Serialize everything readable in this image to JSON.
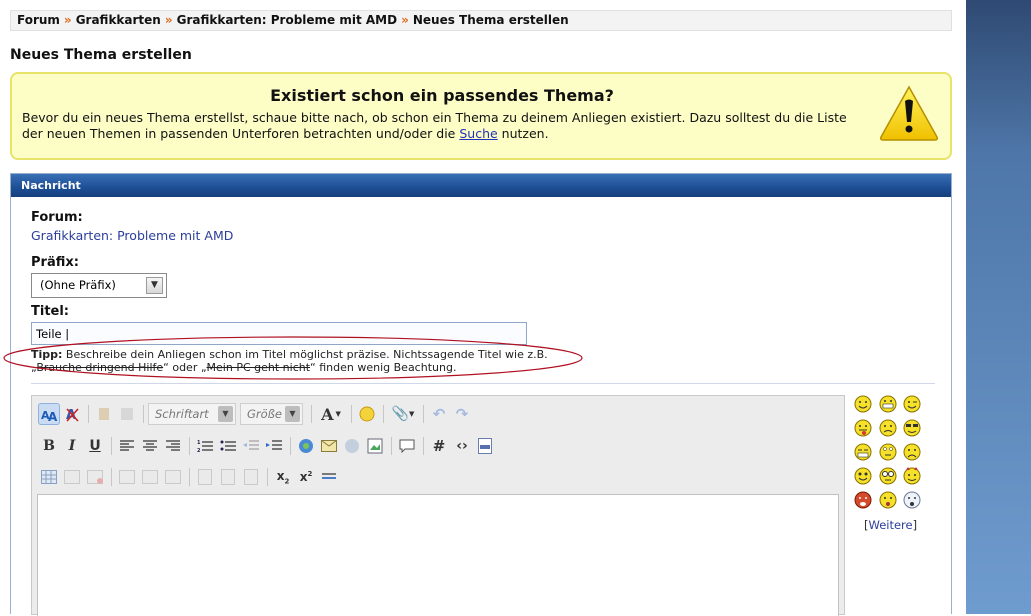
{
  "breadcrumb": {
    "items": [
      "Forum",
      "Grafikkarten",
      "Grafikkarten: Probleme mit AMD",
      "Neues Thema erstellen"
    ],
    "separator": "»"
  },
  "page_title": "Neues Thema erstellen",
  "notice": {
    "title": "Existiert schon ein passendes Thema?",
    "text_before": "Bevor du ein neues Thema erstellst, schaue bitte nach, ob schon ein Thema zu deinem Anliegen existiert. Dazu solltest du die Liste der neuen Themen in passenden Unterforen betrachten und/oder die ",
    "link": "Suche",
    "text_after": " nutzen."
  },
  "panel": {
    "header": "Nachricht",
    "forum_label": "Forum:",
    "forum_value": "Grafikkarten: Probleme mit AMD",
    "prefix_label": "Präfix:",
    "prefix_value": "(Ohne Präfix)",
    "title_label": "Titel:",
    "title_value": "Teile |",
    "tip": {
      "label": "Tipp:",
      "text1": " Beschreibe dein Anliegen schon im Titel möglichst präzise. Nichtssagende Titel wie z.B. „",
      "strike1": "Brauche dringend Hilfe",
      "text2": "“ oder „",
      "strike2": "Mein PC geht nicht",
      "text3": "“ finden wenig Beachtung."
    }
  },
  "editor": {
    "font_combo": "Schriftart",
    "size_combo": "Größe",
    "toolbar_icons": {
      "row1": [
        "switch-mode-icon",
        "remove-format-icon",
        "cut-icon",
        "paste-icon",
        "font-combo",
        "size-combo",
        "font-color-icon",
        "smilie-icon",
        "attachment-icon",
        "undo-icon",
        "redo-icon"
      ],
      "row2": [
        "bold-icon",
        "italic-icon",
        "underline-icon",
        "align-left-icon",
        "align-center-icon",
        "align-right-icon",
        "ordered-list-icon",
        "unordered-list-icon",
        "outdent-icon",
        "indent-icon",
        "link-icon",
        "email-icon",
        "unlink-icon",
        "image-icon",
        "quote-icon",
        "hashtag-icon",
        "code-icon",
        "php-icon"
      ],
      "row3": [
        "table-icon",
        "table-row-icon",
        "table-delete-icon",
        "insert-row-above-icon",
        "insert-row-below-icon",
        "delete-row-icon",
        "insert-col-left-icon",
        "insert-col-right-icon",
        "delete-col-icon",
        "subscript-icon",
        "superscript-icon",
        "horizontal-rule-icon"
      ]
    }
  },
  "smilies": {
    "names": [
      "smile-icon",
      "biggrin-icon",
      "wink-icon",
      "tongue-icon",
      "confused-icon",
      "cool-icon",
      "grin-icon",
      "rolleyes-icon",
      "frown-icon",
      "eek-icon",
      "nerd-icon",
      "devil-icon",
      "mad-icon",
      "surprised-icon",
      "shock-icon"
    ],
    "more_label": "Weitere"
  },
  "colors": {
    "accent_orange": "#e06a1b",
    "panel_header": "#1c4e94",
    "notice_bg": "#fdfdc6",
    "link": "#2b3e9c"
  }
}
